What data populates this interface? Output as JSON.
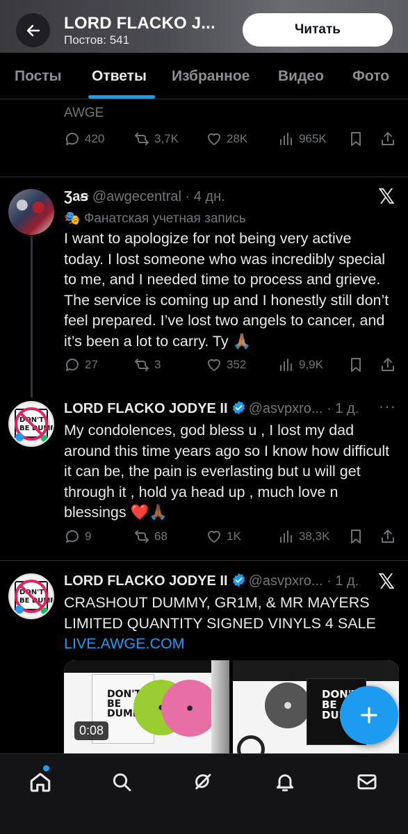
{
  "header": {
    "title": "LORD FLACKO J...",
    "post_count": "Постов: 541",
    "read_button": "Читать"
  },
  "tabs": [
    {
      "label": "Посты",
      "active": false
    },
    {
      "label": "Ответы",
      "active": true
    },
    {
      "label": "Избранное",
      "active": false
    },
    {
      "label": "Видео",
      "active": false
    },
    {
      "label": "Фото",
      "active": false
    }
  ],
  "prev_post": {
    "name_partial": "AWGE",
    "replies": "420",
    "reposts": "3,7K",
    "likes": "28K",
    "views": "965K"
  },
  "post1": {
    "name": "Ʒaꞩ",
    "handle": "@awgecentral",
    "time": "· 4 дн.",
    "fan_label": "Фанатская учетная запись",
    "text": "I want to apologize for not being very active today. I lost someone who was incredibly special to me, and I needed time to process and grieve. The service is coming up and I honestly still don’t feel prepared. I’ve lost two angels to cancer, and it’s been a lot to carry. Ty 🙏🏽",
    "replies": "27",
    "reposts": "3",
    "likes": "352",
    "views": "9,9K"
  },
  "post2": {
    "name": "LORD FLACKO JODYE II",
    "handle": "@asvpxro...",
    "time": "· 1 д.",
    "text": "My condolences, god bless u , I lost my dad around this time years ago so I know how difficult it can be, the pain is everlasting but u will get through it , hold ya head up ,  much love n blessings ❤️🙏🏾",
    "replies": "9",
    "reposts": "68",
    "likes": "1K",
    "views": "38,3K"
  },
  "post3": {
    "name": "LORD FLACKO JODYE II",
    "handle": "@asvpxro...",
    "time": "· 1 д.",
    "text": "CRASHOUT DUMMY, GR1M, & MR MAYERS LIMITED QUANTITY SIGNED VINYLS 4 SALE",
    "link": "LIVE.AWGE.COM",
    "video_duration": "0:08",
    "cover_text_1": "DON'T BE DUMB",
    "cover_text_2": "DON'T BE DUMB"
  },
  "colors": {
    "accent": "#1d9bf0",
    "muted": "#71767b",
    "text": "#e7e9ea",
    "verified": "#1d9bf0",
    "background": "#000000"
  },
  "icons": {
    "back": "arrow-left-icon",
    "reply": "speech-bubble-icon",
    "repost": "repost-arrows-icon",
    "like": "heart-icon",
    "views": "bar-chart-icon",
    "bookmark": "bookmark-icon",
    "share": "share-upload-icon",
    "compose": "plus-icon",
    "nav": [
      "home-icon",
      "search-icon",
      "grok-icon",
      "bell-icon",
      "mail-icon"
    ]
  }
}
